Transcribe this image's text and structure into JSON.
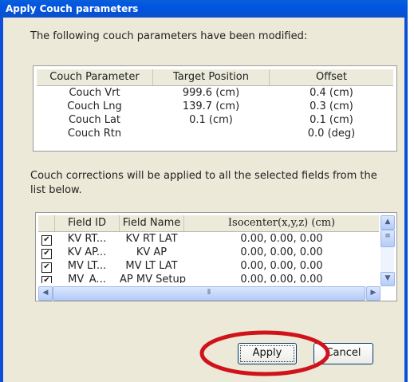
{
  "window": {
    "title": "Apply Couch parameters"
  },
  "intro": "The following couch parameters have been modified:",
  "params_table": {
    "headers": [
      "Couch Parameter",
      "Target Position",
      "Offset"
    ],
    "rows": [
      [
        "Couch Vrt",
        "999.6 (cm)",
        "0.4 (cm)"
      ],
      [
        "Couch Lng",
        "139.7 (cm)",
        "0.3 (cm)"
      ],
      [
        "Couch Lat",
        "0.1 (cm)",
        "0.1 (cm)"
      ],
      [
        "Couch Rtn",
        "",
        "0.0 (deg)"
      ]
    ]
  },
  "note": "Couch corrections will be applied to all the selected fields from the list below.",
  "fields_table": {
    "headers": [
      "Field ID",
      "Field Name",
      "Isocenter(x,y,z) (cm)"
    ],
    "rows": [
      {
        "id": "KV RT...",
        "name": "KV RT LAT",
        "iso": "0.00, 0.00, 0.00",
        "checked": true
      },
      {
        "id": "KV AP...",
        "name": "KV AP",
        "iso": "0.00, 0.00, 0.00",
        "checked": true
      },
      {
        "id": "MV LT...",
        "name": "MV LT LAT",
        "iso": "0.00, 0.00, 0.00",
        "checked": true
      },
      {
        "id": "MV_A...",
        "name": "AP MV Setup",
        "iso": "0.00, 0.00, 0.00",
        "checked": true
      }
    ]
  },
  "buttons": {
    "apply": "Apply",
    "cancel": "Cancel"
  },
  "highlight_color": "#d0121b"
}
